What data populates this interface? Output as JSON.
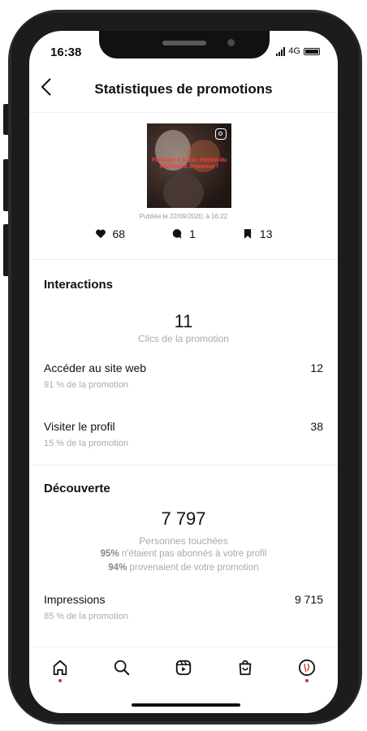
{
  "status": {
    "time": "16:38",
    "network": "4G"
  },
  "header": {
    "title": "Statistiques de promotions",
    "back_icon": "chevron-left-icon"
  },
  "post": {
    "image_caption": "Participe à la 21e édition du Parlement Jeunesse !",
    "published": "Publiée le 22/09/2020, à 16:22",
    "likes": "68",
    "comments": "1",
    "saves": "13"
  },
  "interactions": {
    "title": "Interactions",
    "clicks": "11",
    "clicks_label": "Clics de la promotion",
    "rows": [
      {
        "label": "Accéder au site web",
        "sub": "91 % de la promotion",
        "value": "12"
      },
      {
        "label": "Visiter le profil",
        "sub": "15 % de la promotion",
        "value": "38"
      }
    ]
  },
  "discovery": {
    "title": "Découverte",
    "reach": "7 797",
    "reach_label": "Personnes touchées",
    "line1_pct": "95%",
    "line1_text": " n'étaient pas abonnés à votre profil",
    "line2_pct": "94%",
    "line2_text": " provenaient de votre promotion",
    "impressions_label": "Impressions",
    "impressions_sub": "85 % de la promotion",
    "impressions_value": "9 715"
  },
  "tabbar": {
    "items": [
      "home-icon",
      "search-icon",
      "reels-icon",
      "shop-icon",
      "profile-icon"
    ]
  },
  "colors": {
    "notification_dot": "#e0245e",
    "caption_red": "#ff3c3c"
  }
}
